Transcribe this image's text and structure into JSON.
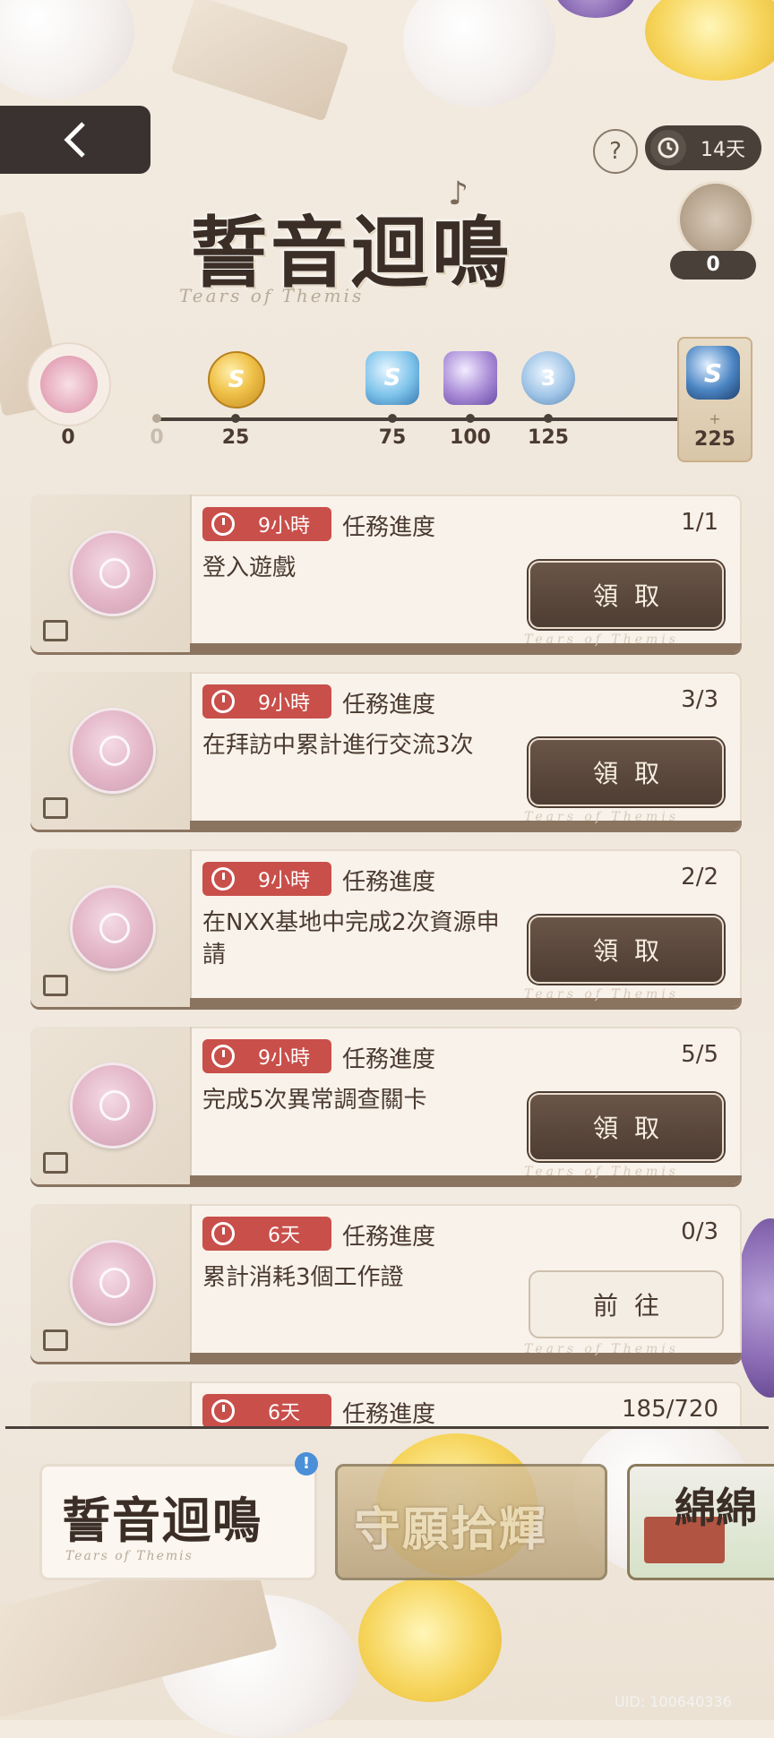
{
  "header": {
    "help_label": "?",
    "timer_label": "14天",
    "pack_count": "0"
  },
  "title": {
    "main": "誓音迴鳴",
    "subtitle": "Tears of Themis"
  },
  "progress": {
    "current_value": "0",
    "start_label": "0",
    "milestones": [
      {
        "label": "25",
        "reward": "gold-coin"
      },
      {
        "label": "75",
        "reward": "blue-crystal"
      },
      {
        "label": "100",
        "reward": "purple-chip"
      },
      {
        "label": "125",
        "reward": "platform-item"
      }
    ],
    "final": {
      "plus": "+",
      "label": "225",
      "gem": "S"
    },
    "coin_letter": "S",
    "crystal_letter": "S",
    "platform_digit": "3"
  },
  "tasks": [
    {
      "time": "9小時",
      "progress_label": "任務進度",
      "progress": "1/1",
      "desc": "登入遊戲",
      "button": "領取",
      "state": "claim"
    },
    {
      "time": "9小時",
      "progress_label": "任務進度",
      "progress": "3/3",
      "desc": "在拜訪中累計進行交流3次",
      "button": "領取",
      "state": "claim"
    },
    {
      "time": "9小時",
      "progress_label": "任務進度",
      "progress": "2/2",
      "desc": "在NXX基地中完成2次資源申請",
      "button": "領取",
      "state": "claim"
    },
    {
      "time": "9小時",
      "progress_label": "任務進度",
      "progress": "5/5",
      "desc": "完成5次異常調查關卡",
      "button": "領取",
      "state": "claim"
    },
    {
      "time": "6天",
      "progress_label": "任務進度",
      "progress": "0/3",
      "desc": "累計消耗3個工作證",
      "button": "前往",
      "state": "go"
    },
    {
      "time": "6天",
      "progress_label": "任務進度",
      "progress": "185/720",
      "desc": "",
      "button": "",
      "state": "partial"
    }
  ],
  "card_watermark": "Tears of Themis",
  "bottom_tabs": [
    {
      "label": "誓音迴鳴",
      "sub": "Tears of Themis",
      "alert": "!"
    },
    {
      "label": "守願拾輝"
    },
    {
      "label": "綿綿"
    }
  ],
  "uid": "UID: 100640336",
  "colors": {
    "accent_red": "#c94f4a",
    "dark_brown": "#4e3d33",
    "background": "#f3ebe0"
  }
}
